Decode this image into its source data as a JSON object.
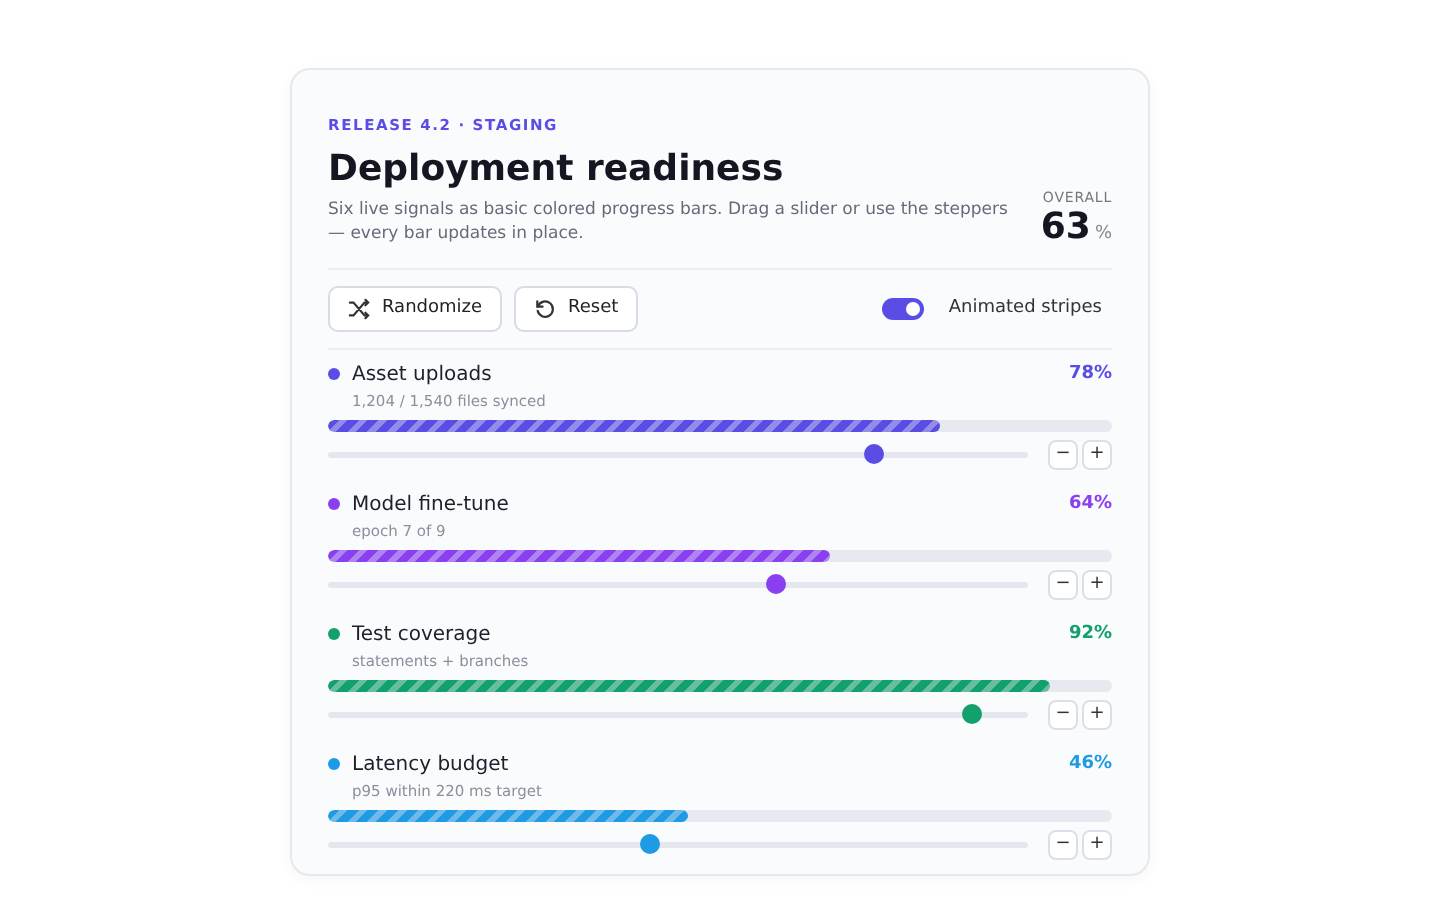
{
  "eyebrow": "RELEASE 4.2 · STAGING",
  "title": "Deployment readiness",
  "description": "Six live signals as basic colored progress bars. Drag a slider or use the steppers — every bar updates in place.",
  "overall": {
    "label": "OVERALL",
    "value": "63",
    "unit": "%"
  },
  "buttons": [
    {
      "label": "Randomize",
      "kind": "shuffle"
    },
    {
      "label": "Reset",
      "kind": "reset"
    }
  ],
  "toggle": {
    "label": "Animated stripes",
    "on": true
  },
  "signals": [
    {
      "name": "Asset uploads",
      "detail": "1,204 / 1,540 files synced",
      "percent": "78%",
      "level": 0.78,
      "color": "#5a4de6",
      "decrement": "−",
      "increment": "+"
    },
    {
      "name": "Model fine-tune",
      "detail": "epoch 7 of 9",
      "percent": "64%",
      "level": 0.64,
      "color": "#8a3ff0",
      "decrement": "−",
      "increment": "+"
    },
    {
      "name": "Test coverage",
      "detail": "statements + branches",
      "percent": "92%",
      "level": 0.92,
      "color": "#12a06c",
      "decrement": "−",
      "increment": "+"
    },
    {
      "name": "Latency budget",
      "detail": "p95 within 220 ms target",
      "percent": "46%",
      "level": 0.46,
      "color": "#1f9ae4",
      "decrement": "−",
      "increment": "+"
    }
  ]
}
